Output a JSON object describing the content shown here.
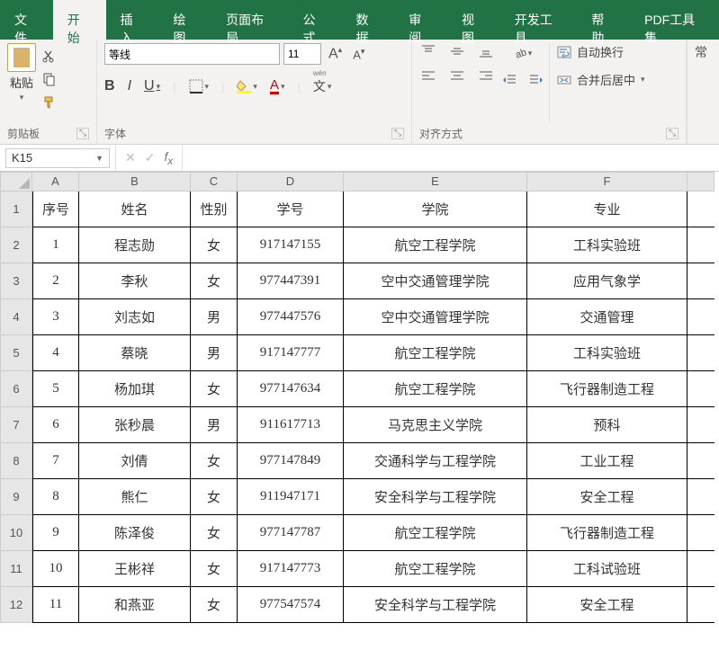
{
  "tabs": [
    "文件",
    "开始",
    "插入",
    "绘图",
    "页面布局",
    "公式",
    "数据",
    "审阅",
    "视图",
    "开发工具",
    "帮助",
    "PDF工具集"
  ],
  "active_tab_index": 1,
  "ribbon": {
    "clipboard": {
      "paste": "粘贴",
      "group_label": "剪贴板"
    },
    "font": {
      "name": "等线",
      "size": "11",
      "group_label": "字体",
      "bold": "B",
      "italic": "I",
      "underline": "U",
      "wen": "文"
    },
    "alignment": {
      "group_label": "对齐方式",
      "wrap": "自动换行",
      "merge": "合并后居中"
    }
  },
  "namebox": "K15",
  "columns": [
    "A",
    "B",
    "C",
    "D",
    "E",
    "F"
  ],
  "col_widths": [
    "wA",
    "wB",
    "wC",
    "wD",
    "wE",
    "wF"
  ],
  "header_row": [
    "序号",
    "姓名",
    "性别",
    "学号",
    "学院",
    "专业"
  ],
  "rows": [
    [
      "1",
      "程志勋",
      "女",
      "917147155",
      "航空工程学院",
      "工科实验班"
    ],
    [
      "2",
      "李秋",
      "女",
      "977447391",
      "空中交通管理学院",
      "应用气象学"
    ],
    [
      "3",
      "刘志如",
      "男",
      "977447576",
      "空中交通管理学院",
      "交通管理"
    ],
    [
      "4",
      "蔡晓",
      "男",
      "917147777",
      "航空工程学院",
      "工科实验班"
    ],
    [
      "5",
      "杨加琪",
      "女",
      "977147634",
      "航空工程学院",
      "飞行器制造工程"
    ],
    [
      "6",
      "张秒晨",
      "男",
      "911617713",
      "马克思主义学院",
      "预科"
    ],
    [
      "7",
      "刘倩",
      "女",
      "977147849",
      "交通科学与工程学院",
      "工业工程"
    ],
    [
      "8",
      "熊仁",
      "女",
      "911947171",
      "安全科学与工程学院",
      "安全工程"
    ],
    [
      "9",
      "陈泽俊",
      "女",
      "977147787",
      "航空工程学院",
      "飞行器制造工程"
    ],
    [
      "10",
      "王彬祥",
      "女",
      "917147773",
      "航空工程学院",
      "工科试验班"
    ],
    [
      "11",
      "和燕亚",
      "女",
      "977547574",
      "安全科学与工程学院",
      "安全工程"
    ]
  ]
}
